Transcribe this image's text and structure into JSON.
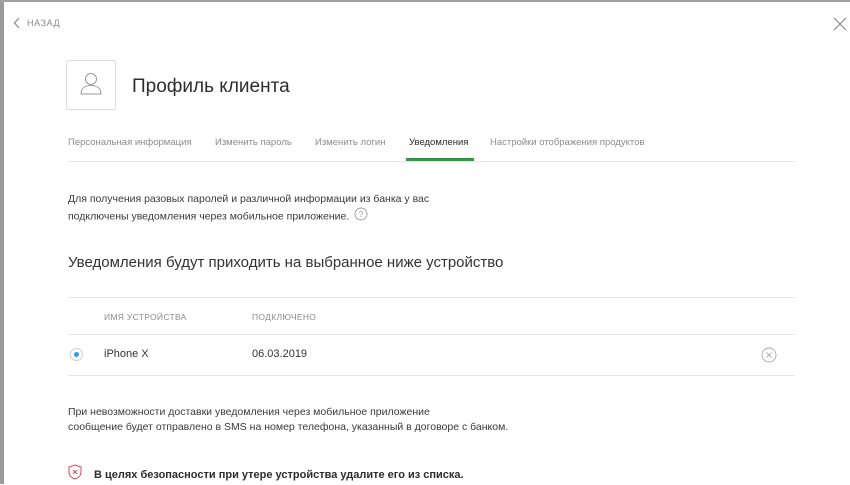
{
  "nav": {
    "back_label": "НАЗАД"
  },
  "profile": {
    "title": "Профиль клиента"
  },
  "tabs": [
    {
      "label": "Персональная информация",
      "active": false
    },
    {
      "label": "Изменить пароль",
      "active": false
    },
    {
      "label": "Изменить логин",
      "active": false
    },
    {
      "label": "Уведомления",
      "active": true
    },
    {
      "label": "Настройки отображения продуктов",
      "active": false
    }
  ],
  "info": {
    "line1": "Для получения разовых паролей и различной информации из банка у вас",
    "line2": "подключены уведомления через мобильное приложение."
  },
  "section_title": "Уведомления будут приходить на выбранное ниже устройство",
  "devices_table": {
    "headers": {
      "device": "ИМЯ УСТРОЙСТВА",
      "connected": "ПОДКЛЮЧЕНО"
    },
    "rows": [
      {
        "device": "iPhone X",
        "connected": "06.03.2019",
        "selected": true
      }
    ]
  },
  "delivery_note": {
    "line1": "При невозможности доставки уведомления через мобильное приложение",
    "line2": "сообщение будет отправлено в SMS на номер телефона, указанный в договоре с банком."
  },
  "security_note": "В целях безопасности при утере устройства удалите его из списка.",
  "colors": {
    "accent_green": "#21a038",
    "radio_blue": "#2a9df4",
    "shield_red": "#e0455a"
  },
  "icons": [
    "chevron-left-icon",
    "close-icon",
    "user-icon",
    "help-icon",
    "remove-icon",
    "shield-icon"
  ]
}
